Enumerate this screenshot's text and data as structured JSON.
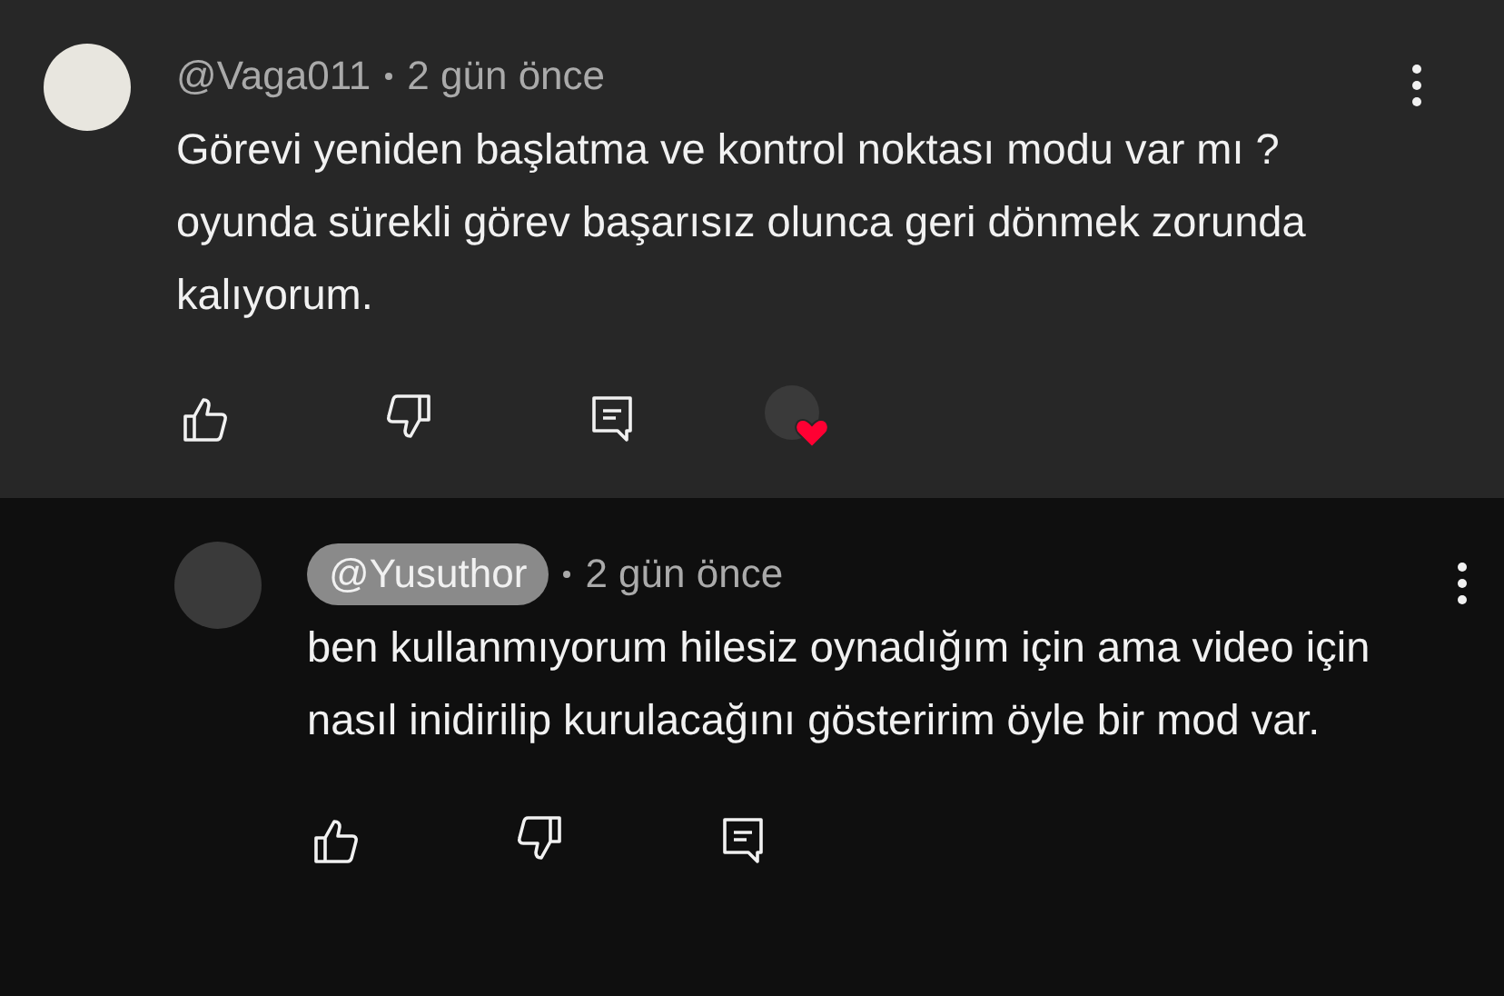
{
  "comments": [
    {
      "author": "@Vaga011",
      "is_creator": false,
      "time": "2 gün önce",
      "text": "Görevi yeniden başlatma ve kontrol noktası modu var mı ? oyunda sürekli görev başarısız olunca geri dönmek zorunda kalıyorum.",
      "creator_hearted": true,
      "replies": [
        {
          "author": "@Yusuthor",
          "is_creator": true,
          "time": "2 gün önce",
          "text": "ben kullanmıyorum hilesiz oynadığım için ama video için nasıl inidirilip kurulacağını gösteririm öyle bir mod var.",
          "creator_hearted": false
        }
      ]
    }
  ]
}
